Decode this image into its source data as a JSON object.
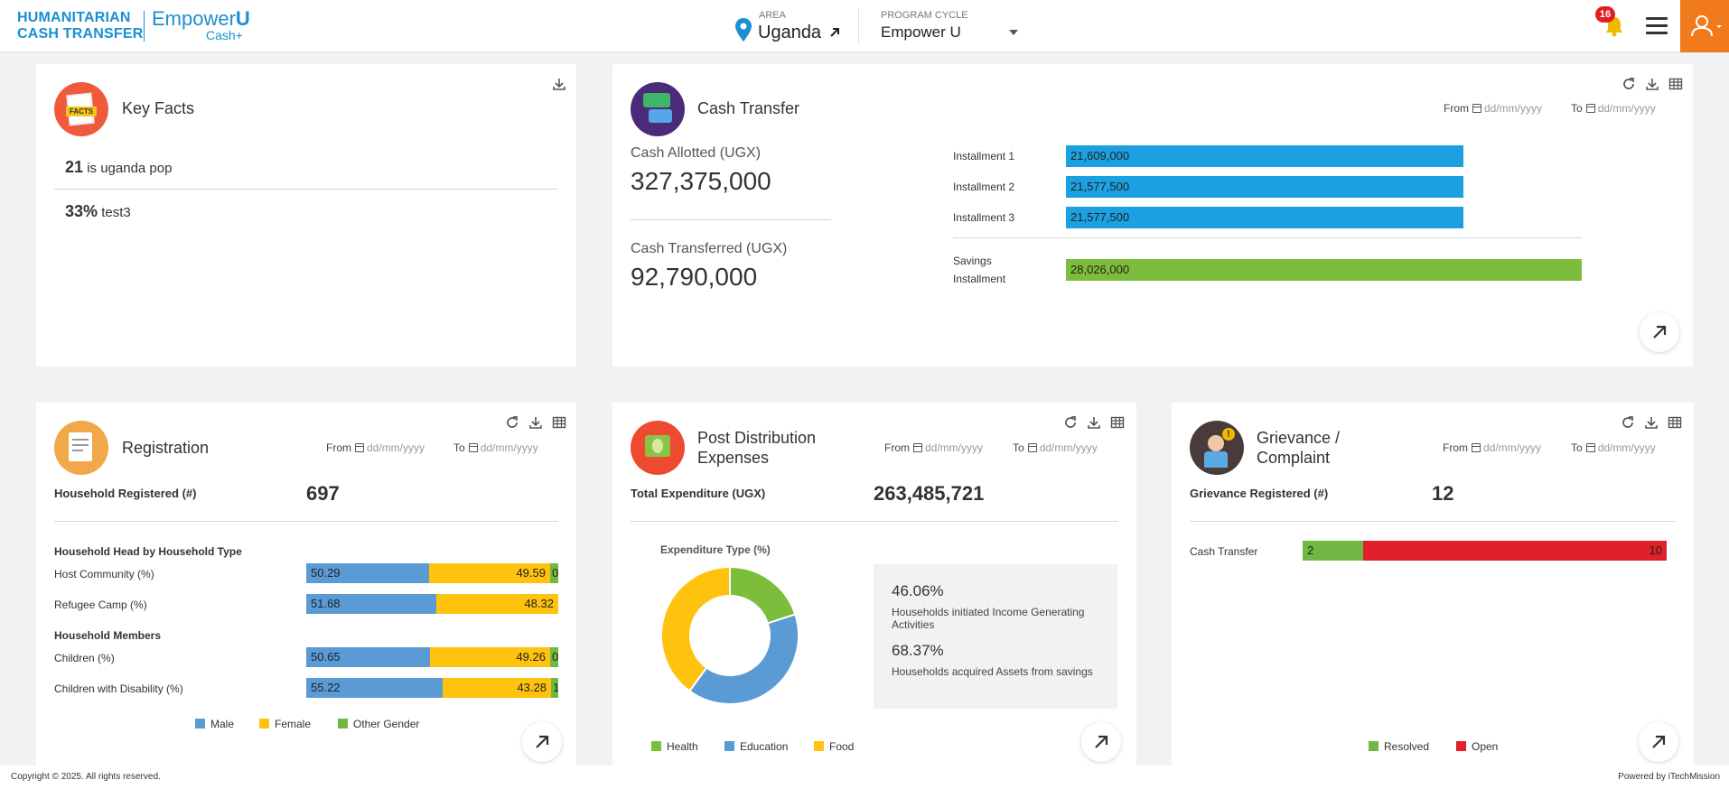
{
  "header": {
    "logo_line1": "HUMANITARIAN",
    "logo_line2": "CASH TRANSFER",
    "logo_empower": "Empower",
    "logo_u": "U",
    "logo_cash": "Cash+",
    "area_label": "AREA",
    "area_value": "Uganda",
    "program_label": "PROGRAM CYCLE",
    "program_value": "Empower U",
    "notification_count": "16"
  },
  "key_facts": {
    "title": "Key Facts",
    "icon_text": "FACTS",
    "facts": [
      {
        "value": "21",
        "text": "is uganda pop"
      },
      {
        "value": "33%",
        "text": "test3"
      }
    ]
  },
  "date_filter": {
    "from": "From",
    "to": "To",
    "placeholder": "dd/mm/yyyy"
  },
  "cash_transfer": {
    "title": "Cash Transfer",
    "allotted_label": "Cash Allotted (UGX)",
    "allotted_value": "327,375,000",
    "transferred_label": "Cash Transferred (UGX)",
    "transferred_value": "92,790,000",
    "installments": [
      {
        "label": "Installment 1",
        "value": "21,609,000"
      },
      {
        "label": "Installment 2",
        "value": "21,577,500"
      },
      {
        "label": "Installment 3",
        "value": "21,577,500"
      }
    ],
    "savings_label_1": "Savings",
    "savings_label_2": "Installment",
    "savings_value": "28,026,000",
    "colors": {
      "installment": "#1ba1e2",
      "savings": "#7cbd3c"
    }
  },
  "registration": {
    "title": "Registration",
    "households_label": "Household Registered (#)",
    "households_value": "697",
    "section_type": "Household Head by Household Type",
    "section_members": "Household Members",
    "rows": [
      {
        "label": "Host Community (%)",
        "male": "50.29",
        "female": "49.59",
        "other": "0.12"
      },
      {
        "label": "Refugee Camp (%)",
        "male": "51.68",
        "female": "48.32",
        "other": ""
      },
      {
        "label": "Children (%)",
        "male": "50.65",
        "female": "49.26",
        "other": "0.09"
      },
      {
        "label": "Children with Disability (%)",
        "male": "55.22",
        "female": "43.28",
        "other": "1.50"
      }
    ],
    "legend": [
      "Male",
      "Female",
      "Other Gender"
    ],
    "colors": {
      "male": "#5b9bd5",
      "female": "#ffc20e",
      "other": "#70b843"
    }
  },
  "post_distribution": {
    "title_line1": "Post Distribution",
    "title_line2": "Expenses",
    "total_label": "Total Expenditure (UGX)",
    "total_value": "263,485,721",
    "chart_title": "Expenditure Type (%)",
    "stat1_value": "46.06%",
    "stat1_text": "Households initiated Income Generating Activities",
    "stat2_value": "68.37%",
    "stat2_text": "Households acquired Assets from savings",
    "legend": [
      "Health",
      "Education",
      "Food"
    ]
  },
  "grievance": {
    "title_line1": "Grievance /",
    "title_line2": "Complaint",
    "registered_label": "Grievance Registered (#)",
    "registered_value": "12",
    "row_label": "Cash Transfer",
    "resolved": "2",
    "open": "10",
    "legend": [
      "Resolved",
      "Open"
    ],
    "colors": {
      "resolved": "#70b843",
      "open": "#e0202a"
    }
  },
  "chart_data": {
    "type": "pie",
    "title": "Expenditure Type (%)",
    "categories": [
      "Health",
      "Education",
      "Food"
    ],
    "values": [
      20,
      40,
      40
    ],
    "colors": [
      "#7cbd3c",
      "#5b9bd5",
      "#ffc20e"
    ]
  },
  "footer": {
    "copyright": "Copyright © 2025. All rights reserved.",
    "powered": "Powered by  iTechMission"
  }
}
